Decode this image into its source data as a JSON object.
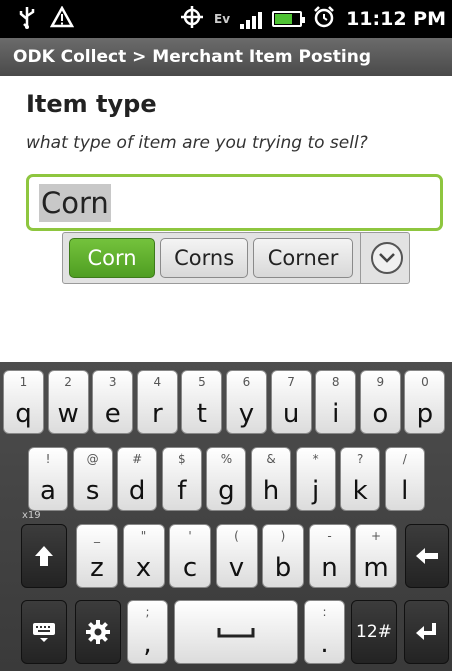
{
  "status_bar": {
    "time": "11:12 PM",
    "network_badge": "Ev",
    "battery_level": 0.7,
    "icons": [
      "usb-icon",
      "warning-icon",
      "gps-icon",
      "data-activity-icon",
      "signal-icon",
      "battery-icon",
      "alarm-icon"
    ]
  },
  "title_bar": {
    "title": "ODK Collect > Merchant Item Posting"
  },
  "question": {
    "label": "Item type",
    "hint": "what type of item are you trying to sell?",
    "answer": "Corn"
  },
  "suggestions": {
    "items": [
      "Corn",
      "Corns",
      "Corner"
    ],
    "selected_index": 0,
    "expand_icon": "chevron-down-icon"
  },
  "keyboard": {
    "row1": [
      {
        "key": "q",
        "sec": "1"
      },
      {
        "key": "w",
        "sec": "2"
      },
      {
        "key": "e",
        "sec": "3"
      },
      {
        "key": "r",
        "sec": "4"
      },
      {
        "key": "t",
        "sec": "5"
      },
      {
        "key": "y",
        "sec": "6"
      },
      {
        "key": "u",
        "sec": "7"
      },
      {
        "key": "i",
        "sec": "8"
      },
      {
        "key": "o",
        "sec": "9"
      },
      {
        "key": "p",
        "sec": "0"
      }
    ],
    "row2": [
      {
        "key": "a",
        "sec": "!"
      },
      {
        "key": "s",
        "sec": "@"
      },
      {
        "key": "d",
        "sec": "#"
      },
      {
        "key": "f",
        "sec": "$"
      },
      {
        "key": "g",
        "sec": "%"
      },
      {
        "key": "h",
        "sec": "&"
      },
      {
        "key": "j",
        "sec": "*"
      },
      {
        "key": "k",
        "sec": "?"
      },
      {
        "key": "l",
        "sec": "/"
      }
    ],
    "row3": [
      {
        "key": "z",
        "sec": "_"
      },
      {
        "key": "x",
        "sec": "\""
      },
      {
        "key": "c",
        "sec": "'"
      },
      {
        "key": "v",
        "sec": "("
      },
      {
        "key": "b",
        "sec": ")"
      },
      {
        "key": "n",
        "sec": "-"
      },
      {
        "key": "m",
        "sec": "+"
      }
    ],
    "row4": {
      "comma": ",",
      "comma_sec": ";",
      "period": ".",
      "period_sec": ":",
      "sym_label": "12#"
    },
    "row3_left_label": "x19",
    "special_icons": [
      "shift-icon",
      "backspace-icon",
      "keyboard-icon",
      "gear-icon",
      "space-icon",
      "enter-icon"
    ]
  },
  "colors": {
    "accent_green": "#8ec63f",
    "selected_green": "#5aa82b",
    "title_bar": "#5a5a5a"
  }
}
